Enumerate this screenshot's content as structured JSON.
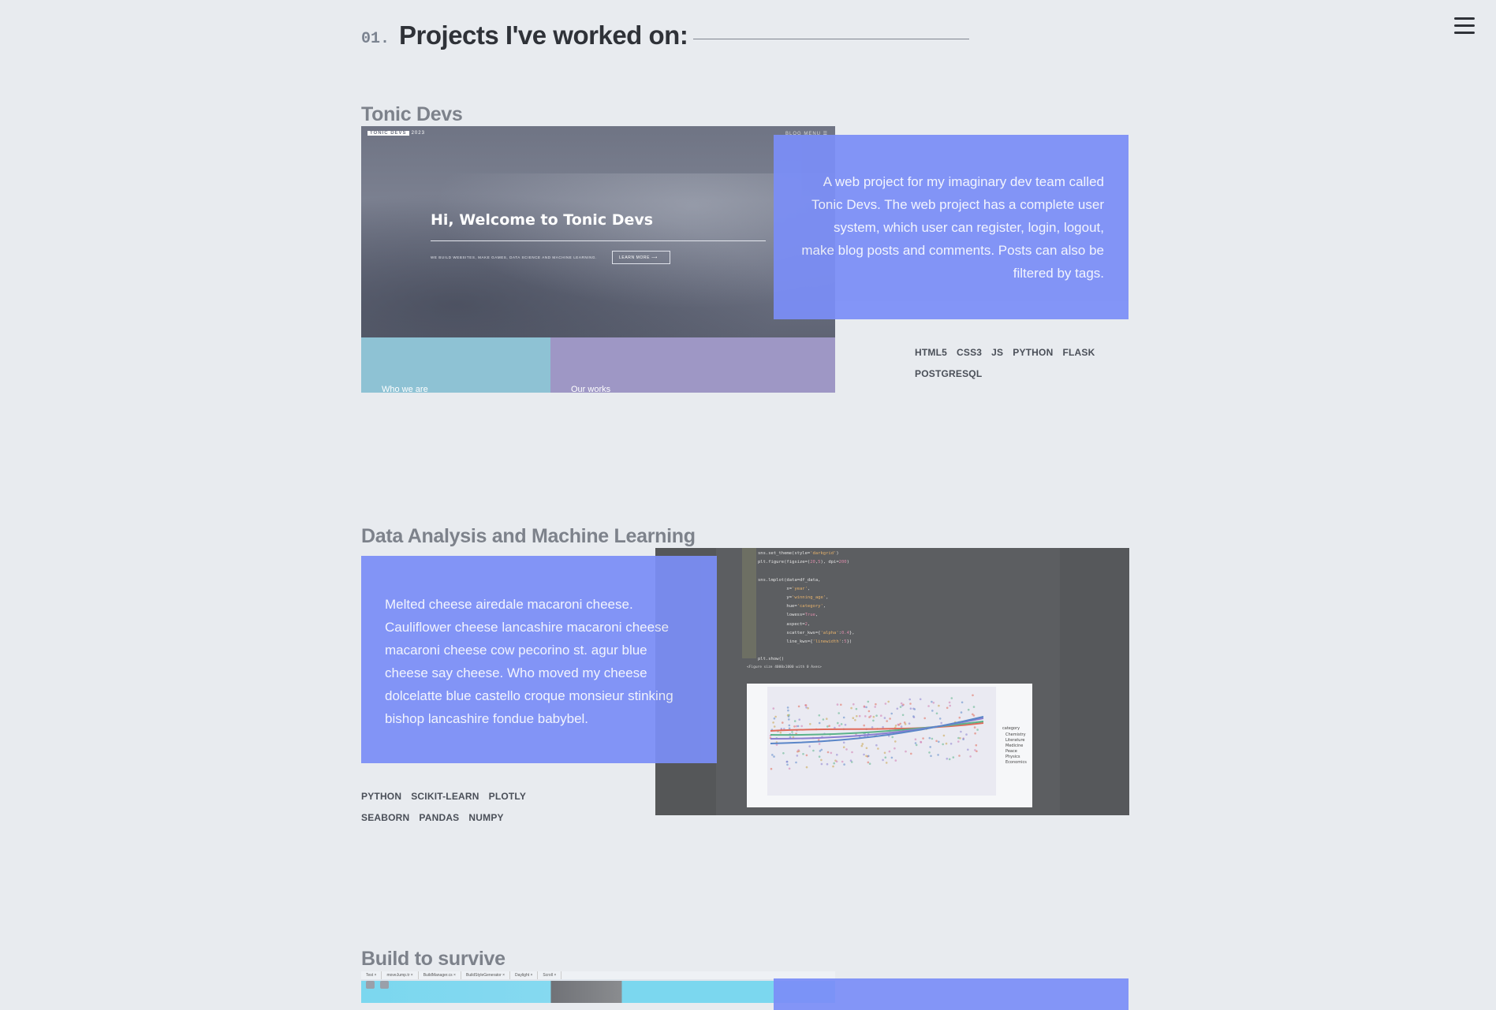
{
  "section": {
    "number": "01.",
    "title": "Projects I've worked on:"
  },
  "projects": [
    {
      "title": "Tonic Devs",
      "description": "A web project for my imaginary dev team called Tonic Devs. The web project has a complete user system, which user can register, login, logout, make blog posts and comments. Posts can also be filtered by tags.",
      "tags": [
        "HTML5",
        "CSS3",
        "JS",
        "PYTHON",
        "FLASK",
        "POSTGRESQL"
      ],
      "screenshot": {
        "brand_box": "TONIC DEVS",
        "brand_year": "2023",
        "nav": "BLOG    MENU ☰",
        "hero_title": "Hi, Welcome to Tonic Devs",
        "hero_tagline": "WE BUILD WEBSITES, MAKE GAMES, DATA SCIENCE AND MACHINE LEARNING.",
        "hero_button": "LEARN MORE ⟶",
        "block_left": "Who we are",
        "block_right": "Our works"
      }
    },
    {
      "title": "Data Analysis and Machine Learning",
      "description": "Melted cheese airedale macaroni cheese. Cauliflower cheese lancashire macaroni cheese macaroni cheese cow pecorino st. agur blue cheese say cheese. Who moved my cheese dolcelatte blue castello croque monsieur stinking bishop lancashire fondue babybel.",
      "tags_row1": [
        "PYTHON",
        "SCIKIT-LEARN",
        "PLOTLY"
      ],
      "tags_row2": [
        "SEABORN",
        "PANDAS",
        "NUMPY"
      ],
      "screenshot": {
        "figure_text": "<Figure size 4000x1000 with 0 Axes>",
        "legend_title": "category",
        "legend_items": [
          "Chemistry",
          "Literature",
          "Medicine",
          "Peace",
          "Physics",
          "Economics"
        ]
      }
    },
    {
      "title": "Build to survive",
      "screenshot": {
        "tabs": [
          "Test ×",
          "moveJump.tr ×",
          "BuildManager.cs ×",
          "BuildStyleGenerator ×",
          "Daylight ×",
          "Scroll ×"
        ]
      }
    }
  ],
  "colors": {
    "background": "#e8ebef",
    "card": "#7b8ef7",
    "heading": "#2f3238",
    "project_title": "#7d828b"
  }
}
